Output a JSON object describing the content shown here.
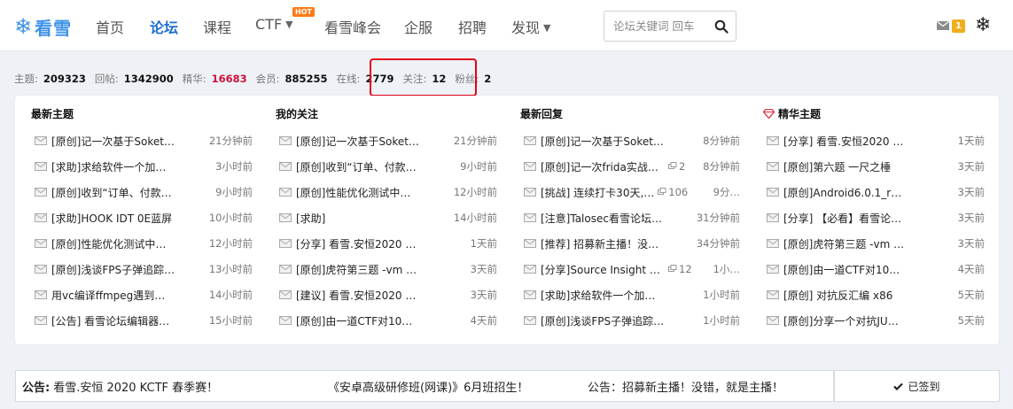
{
  "nav": {
    "logo_text": "看雪",
    "items": [
      {
        "label": "首页"
      },
      {
        "label": "论坛"
      },
      {
        "label": "课程"
      },
      {
        "label": "CTF",
        "badge": "HOT"
      },
      {
        "label": "看雪峰会"
      },
      {
        "label": "企服"
      },
      {
        "label": "招聘"
      },
      {
        "label": "发现"
      }
    ],
    "search_placeholder": "论坛关键词 回车",
    "mail_count": "1",
    "icons": {
      "logo": "snowflake-icon",
      "search": "search-icon",
      "mail": "mail-icon",
      "user": "snowflake-avatar-icon"
    },
    "colors": {
      "brand": "#3f93e8",
      "active": "#1a6fd0",
      "hot": "#ff7a18",
      "badge": "#f0ad1d"
    }
  },
  "stats": [
    {
      "label": "主题:",
      "value": "209323"
    },
    {
      "label": "回帖:",
      "value": "1342900"
    },
    {
      "label": "精华:",
      "value": "16683",
      "highlight": true
    },
    {
      "label": "会员:",
      "value": "885255"
    },
    {
      "label": "在线:",
      "value": "2779"
    },
    {
      "label": "关注:",
      "value": "12"
    },
    {
      "label": "粉丝:",
      "value": "2"
    }
  ],
  "columns": [
    {
      "title": "最新主题",
      "rows": [
        {
          "title": "[原创]记一次基于Soket…",
          "time": "21分钟前"
        },
        {
          "title": "[求助]求给软件一个加密…",
          "time": "3小时前"
        },
        {
          "title": "[原创]收到“订单、付款…",
          "time": "9小时前"
        },
        {
          "title": "[求助]HOOK IDT 0E蓝屏",
          "time": "10小时前"
        },
        {
          "title": "[原创]性能优化测试中的…",
          "time": "12小时前"
        },
        {
          "title": "[原创]浅谈FPS子弹追踪…",
          "time": "13小时前"
        },
        {
          "title": "用vc编译ffmpeg遇到了…",
          "time": "14小时前"
        },
        {
          "title": "[公告] 看雪论坛编辑器…",
          "time": "15小时前"
        }
      ]
    },
    {
      "title": "我的关注",
      "rows": [
        {
          "title": "[原创]记一次基于Soket…",
          "time": "21分钟前"
        },
        {
          "title": "[原创]收到“订单、付款…",
          "time": "9小时前"
        },
        {
          "title": "[原创]性能优化测试中的…",
          "time": "12小时前"
        },
        {
          "title": "[求助]",
          "time": "14小时前"
        },
        {
          "title": "[分享] 看雪.安恒2020 K…",
          "time": "1天前"
        },
        {
          "title": "[原创]虎符第三题 -vm …",
          "time": "3天前"
        },
        {
          "title": "[建议] 看雪.安恒2020 K…",
          "time": "3天前"
        },
        {
          "title": "[原创]由一道CTF对10种…",
          "time": "4天前"
        }
      ]
    },
    {
      "title": "最新回复",
      "rows": [
        {
          "title": "[原创]记一次基于Soket…",
          "time": "8分钟前"
        },
        {
          "title": "[原创]记一次frida实战—…",
          "reply": "2",
          "time": "8分钟前"
        },
        {
          "title": "[挑战] 连续打卡30天,…",
          "reply": "106",
          "time": "9分…"
        },
        {
          "title": "[注意]Talosec看雪论坛…",
          "time": "31分钟前"
        },
        {
          "title": "[推荐] 招募新主播！没…",
          "time": "34分钟前"
        },
        {
          "title": "[分享]Source Insight 4.0…",
          "reply": "12",
          "time": "1小…"
        },
        {
          "title": "[求助]求给软件一个加密…",
          "time": "1小时前"
        },
        {
          "title": "[原创]浅谈FPS子弹追踪…",
          "time": "1小时前"
        }
      ]
    },
    {
      "title": "精华主题",
      "icon": "diamond-icon",
      "rows": [
        {
          "title": "[分享] 看雪.安恒2020 K…",
          "time": "1天前"
        },
        {
          "title": "[原创]第六题 一尺之棰",
          "time": "3天前"
        },
        {
          "title": "[原创]Android6.0.1_r77…",
          "time": "3天前"
        },
        {
          "title": "[分享] 【必看】看雪论…",
          "time": "3天前"
        },
        {
          "title": "[原创]虎符第三题 -vm …",
          "time": "3天前"
        },
        {
          "title": "[原创]由一道CTF对10种…",
          "time": "4天前"
        },
        {
          "title": "[原创] 对抗反汇编 x86",
          "time": "5天前"
        },
        {
          "title": "[原创]分享一个对抗JUM…",
          "time": "5天前"
        }
      ]
    }
  ],
  "notice": {
    "label": "公告:",
    "items": [
      "看雪.安恒 2020 KCTF 春季赛！",
      "《安卓高级研修班(网课)》6月班招生！",
      "公告：招募新主播！没错，就是主播！"
    ]
  },
  "signin": {
    "label": "已签到",
    "icon": "check-icon"
  }
}
